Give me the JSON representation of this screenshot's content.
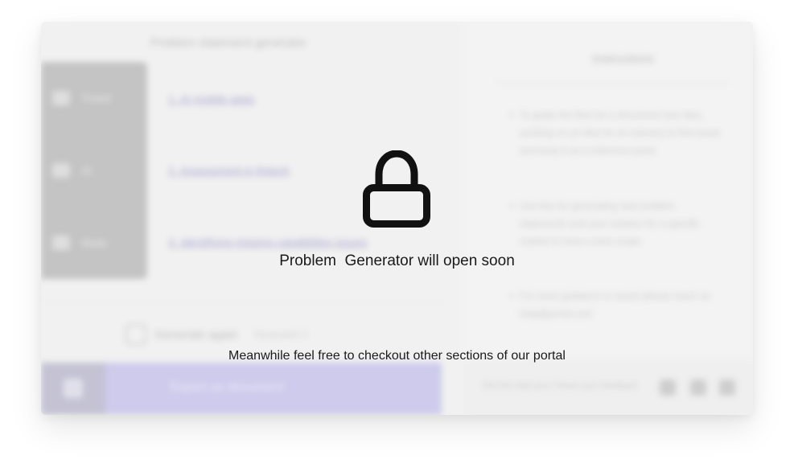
{
  "lock_overlay": {
    "title": "Problem  Generator will open soon",
    "subtitle": "Meanwhile feel free to checkout other sections of our portal",
    "icon": "lock-icon"
  },
  "background": {
    "left_pane": {
      "title": "Problem statement generator",
      "menu_items": [
        {
          "label": "Trend",
          "icon": "trend-icon"
        },
        {
          "label": "AI",
          "icon": "ai-icon"
        },
        {
          "label": "Write",
          "icon": "write-icon"
        }
      ],
      "links": [
        "1. AI mobile apps",
        "2. Assessment in fintech",
        "3. Identifying missing capabilities issues"
      ],
      "regenerate": {
        "label": "Generate again",
        "hint": "Generated 3"
      },
      "action_bar_label": "Export as document"
    },
    "right_pane": {
      "title": "Instructions",
      "paragraphs": [
        "To guide the flow for a structured new idea, working on an idea for an industry to find areas and keep it as a reference point.",
        "Use this for generating new problem statements and your solution for a specific market to have a best scope",
        "For more guidance or assist please reach us help@portal.com"
      ],
      "feedback_label": "Did this help you? Share your feedback",
      "feedback_icons": [
        "thumbs-up-icon",
        "neutral-icon",
        "thumbs-down-icon"
      ]
    }
  },
  "colors": {
    "card_bg": "#efefef",
    "action_bar": "#b8b4e6",
    "side_menu": "#a9a9a9",
    "link": "#7c77b8",
    "text_dark": "#1a1a1a"
  }
}
